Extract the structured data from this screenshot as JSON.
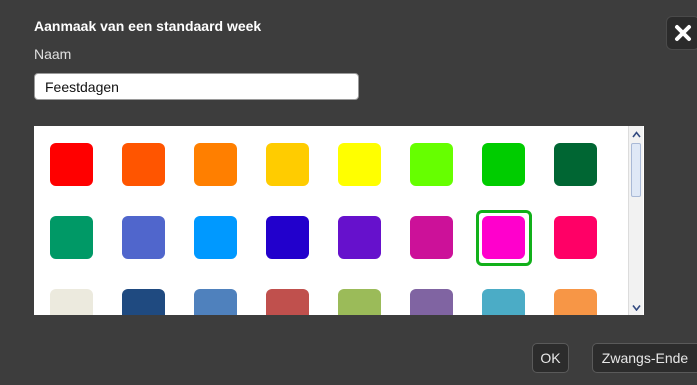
{
  "dialog": {
    "title": "Aanmaak van een standaard week",
    "close_icon": "close-icon"
  },
  "name_field": {
    "label": "Naam",
    "value": "Feestdagen"
  },
  "palette": {
    "selected_index": 14,
    "selected_color": "#ff00cc",
    "selection_ring_color": "#11b01a",
    "colors": [
      "#ff0000",
      "#ff5500",
      "#ff7f00",
      "#ffcc00",
      "#ffff00",
      "#66ff00",
      "#00cc00",
      "#006633",
      "#009966",
      "#5066cc",
      "#0099ff",
      "#2200cc",
      "#6611cc",
      "#cc1199",
      "#ff00cc",
      "#ff0066",
      "#eceade",
      "#1f4a80",
      "#4f81bd",
      "#c0504d",
      "#9bbb59",
      "#8064a2",
      "#4bacc6",
      "#f79646"
    ]
  },
  "scrollbar": {
    "up_icon": "chevron-up-icon",
    "down_icon": "chevron-down-icon"
  },
  "buttons": {
    "ok_label": "OK",
    "force_end_label": "Zwangs-Ende"
  }
}
